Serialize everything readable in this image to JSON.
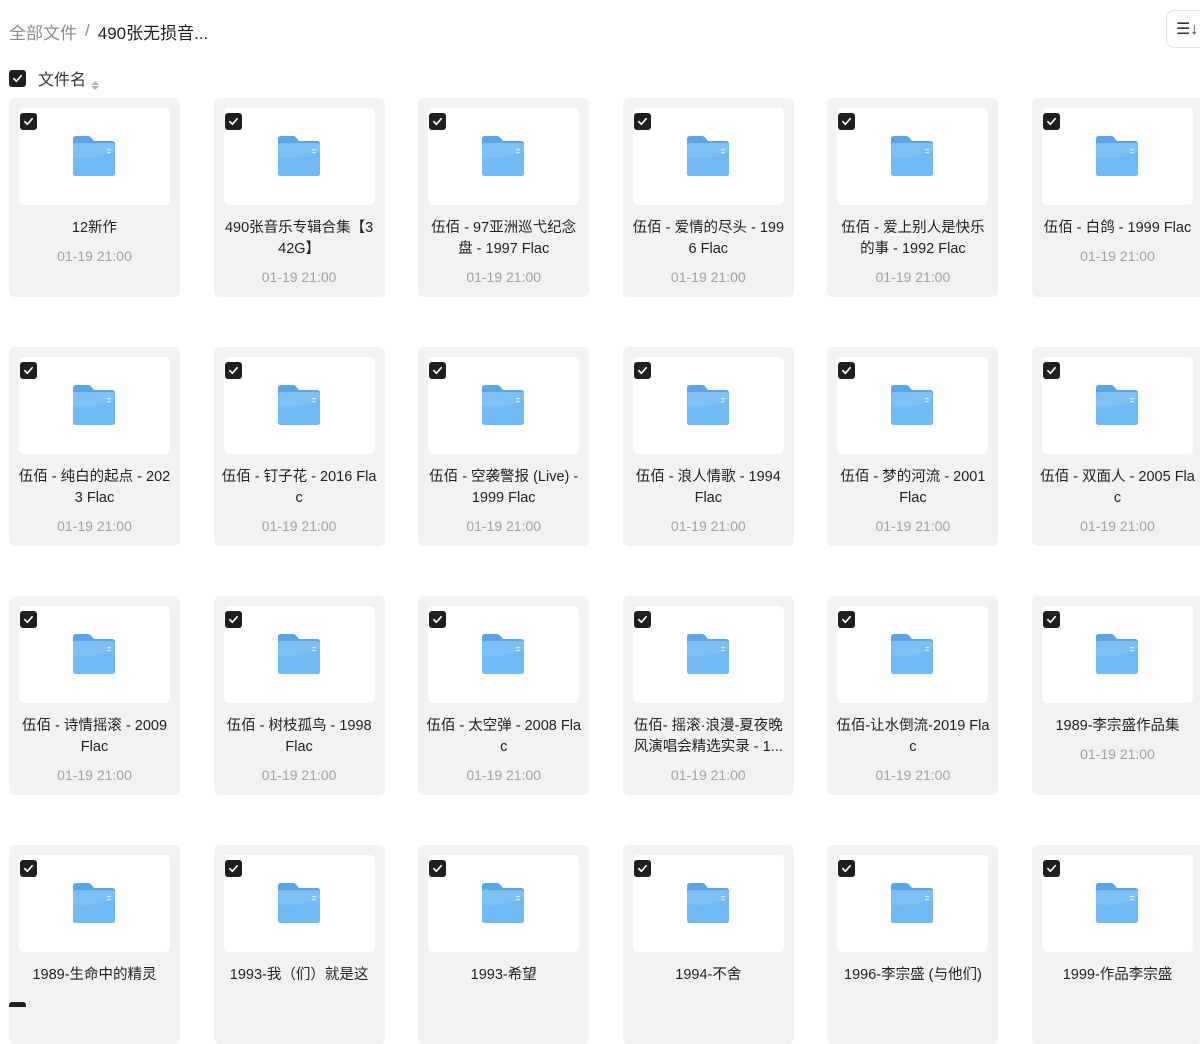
{
  "breadcrumb": {
    "root": "全部文件",
    "separator": "/",
    "current": "490张无损音..."
  },
  "toolbar": {
    "sort_icon": "list-sort-icon",
    "sort_glyph": "☰↓"
  },
  "list_header": {
    "column_label": "文件名",
    "select_all_checked": true
  },
  "colors": {
    "card_bg": "#f2f2f2",
    "checkbox": "#1f1f1f",
    "folder_blue": "#69b4f2",
    "date_gray": "#a0a0a0"
  },
  "items": [
    {
      "name": "12新作",
      "date": "01-19 21:00",
      "checked": true
    },
    {
      "name": "490张音乐专辑合集【342G】",
      "date": "01-19 21:00",
      "checked": true
    },
    {
      "name": "伍佰 - 97亚洲巡弋纪念盘 - 1997 Flac",
      "date": "01-19 21:00",
      "checked": true
    },
    {
      "name": "伍佰 - 爱情的尽头 - 1996 Flac",
      "date": "01-19 21:00",
      "checked": true
    },
    {
      "name": "伍佰 - 爱上别人是快乐的事 - 1992 Flac",
      "date": "01-19 21:00",
      "checked": true
    },
    {
      "name": "伍佰 - 白鸽 - 1999 Flac",
      "date": "01-19 21:00",
      "checked": true
    },
    {
      "name": "伍佰 - 纯白的起点 - 2023 Flac",
      "date": "01-19 21:00",
      "checked": true
    },
    {
      "name": "伍佰 - 钉子花 - 2016 Flac",
      "date": "01-19 21:00",
      "checked": true
    },
    {
      "name": "伍佰 - 空袭警报 (Live) - 1999 Flac",
      "date": "01-19 21:00",
      "checked": true
    },
    {
      "name": "伍佰 - 浪人情歌 - 1994 Flac",
      "date": "01-19 21:00",
      "checked": true
    },
    {
      "name": "伍佰 - 梦的河流 - 2001 Flac",
      "date": "01-19 21:00",
      "checked": true
    },
    {
      "name": "伍佰 - 双面人 - 2005 Flac",
      "date": "01-19 21:00",
      "checked": true
    },
    {
      "name": "伍佰 - 诗情摇滚 - 2009 Flac",
      "date": "01-19 21:00",
      "checked": true
    },
    {
      "name": "伍佰 - 树枝孤鸟 - 1998 Flac",
      "date": "01-19 21:00",
      "checked": true
    },
    {
      "name": "伍佰 - 太空弹 - 2008 Flac",
      "date": "01-19 21:00",
      "checked": true
    },
    {
      "name": "伍佰- 摇滚·浪漫-夏夜晚风演唱会精选实录 - 1...",
      "date": "01-19 21:00",
      "checked": true
    },
    {
      "name": "伍佰-让水倒流-2019 Flac",
      "date": "01-19 21:00",
      "checked": true
    },
    {
      "name": "1989-李宗盛作品集",
      "date": "01-19 21:00",
      "checked": true
    },
    {
      "name": "1989-生命中的精灵",
      "date": "",
      "checked": true
    },
    {
      "name": "1993-我（们）就是这",
      "date": "",
      "checked": true
    },
    {
      "name": "1993-希望",
      "date": "",
      "checked": true
    },
    {
      "name": "1994-不舍",
      "date": "",
      "checked": true
    },
    {
      "name": "1996-李宗盛 (与他们)",
      "date": "",
      "checked": true
    },
    {
      "name": "1999-作品李宗盛",
      "date": "",
      "checked": true
    }
  ]
}
